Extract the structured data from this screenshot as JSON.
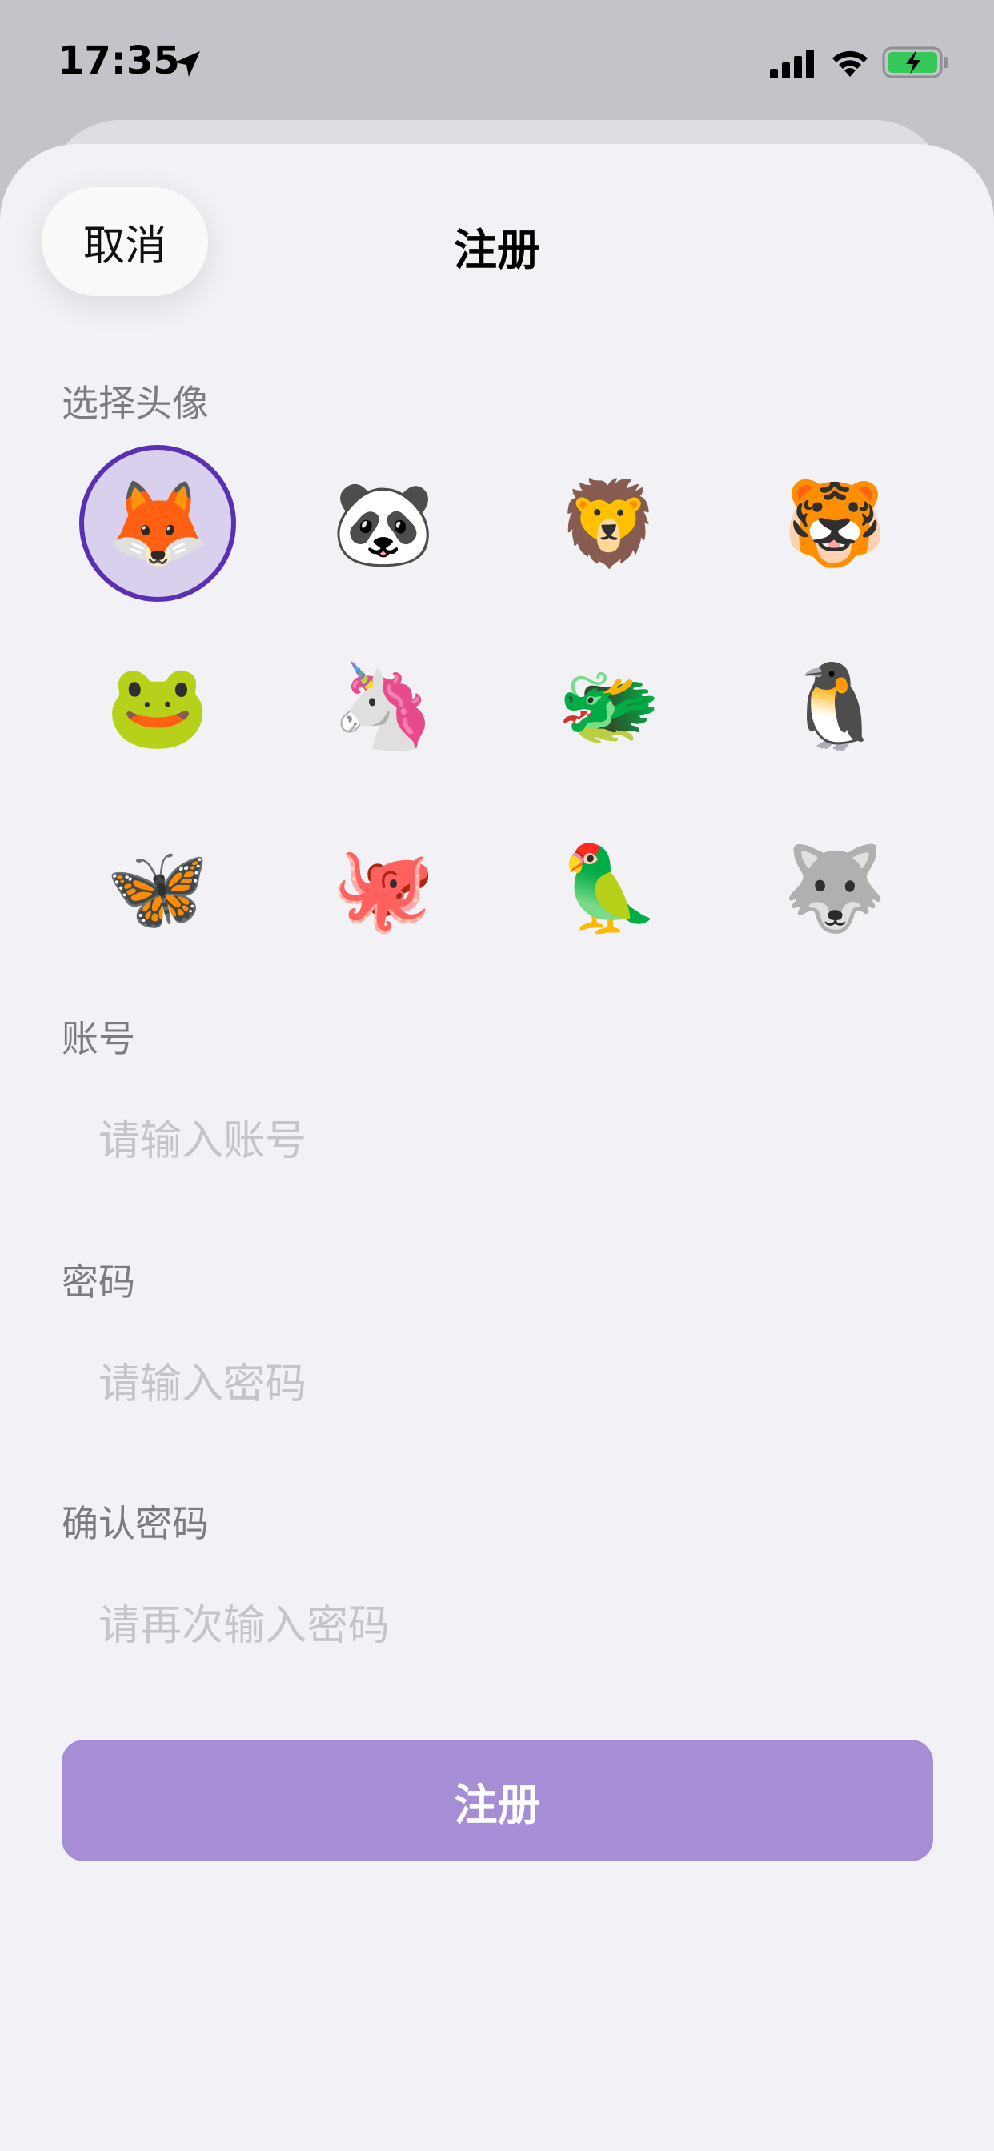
{
  "status_bar": {
    "time": "17:35"
  },
  "header": {
    "cancel_label": "取消",
    "title": "注册"
  },
  "avatar_section": {
    "label": "选择头像",
    "selected_index": 0,
    "avatars": [
      {
        "emoji": "🦊",
        "name": "fox"
      },
      {
        "emoji": "🐼",
        "name": "panda"
      },
      {
        "emoji": "🦁",
        "name": "lion"
      },
      {
        "emoji": "🐯",
        "name": "tiger"
      },
      {
        "emoji": "🐸",
        "name": "frog"
      },
      {
        "emoji": "🦄",
        "name": "unicorn"
      },
      {
        "emoji": "🐲",
        "name": "dragon"
      },
      {
        "emoji": "🐧",
        "name": "penguin"
      },
      {
        "emoji": "🦋",
        "name": "butterfly"
      },
      {
        "emoji": "🐙",
        "name": "octopus"
      },
      {
        "emoji": "🦜",
        "name": "parrot"
      },
      {
        "emoji": "🐺",
        "name": "wolf"
      }
    ]
  },
  "form": {
    "account": {
      "label": "账号",
      "placeholder": "请输入账号",
      "value": ""
    },
    "password": {
      "label": "密码",
      "placeholder": "请输入密码",
      "value": ""
    },
    "confirm_password": {
      "label": "确认密码",
      "placeholder": "请再次输入密码",
      "value": ""
    }
  },
  "submit_label": "注册",
  "colors": {
    "accent": "#5b2fb4",
    "submit_bg": "#a68ed6",
    "selected_bg": "#d8d0ec",
    "label_gray": "#7c7b80",
    "placeholder_gray": "#c5c4c9",
    "sheet_bg": "#f2f1f6",
    "battery_green": "#34c759"
  },
  "icons": {
    "location": "location-arrow-icon",
    "signal": "cellular-signal-icon",
    "wifi": "wifi-icon",
    "battery": "battery-charging-icon"
  }
}
